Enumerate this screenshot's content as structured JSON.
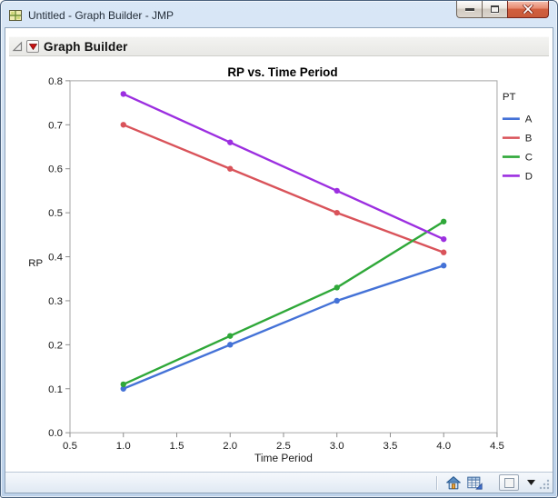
{
  "window": {
    "title": "Untitled - Graph Builder - JMP",
    "app_icon": "jmp-grid-icon",
    "controls": [
      {
        "id": "minimize",
        "icon": "minimize-icon"
      },
      {
        "id": "restore",
        "icon": "restore-icon"
      },
      {
        "id": "close",
        "icon": "close-icon"
      }
    ]
  },
  "report": {
    "outline_title": "Graph Builder",
    "disclosure_icon": "disclosure-triangle-icon",
    "menu_icon": "red-triangle-menu-icon"
  },
  "chart_data": {
    "type": "line",
    "title": "RP vs. Time Period",
    "xlabel": "Time Period",
    "ylabel": "RP",
    "legend_title": "PT",
    "legend_position": "right",
    "grid": false,
    "xlim": [
      0.5,
      4.5
    ],
    "ylim": [
      0.0,
      0.8
    ],
    "x_ticks": [
      0.5,
      1.0,
      1.5,
      2.0,
      2.5,
      3.0,
      3.5,
      4.0,
      4.5
    ],
    "y_ticks": [
      0.0,
      0.1,
      0.2,
      0.3,
      0.4,
      0.5,
      0.6,
      0.7,
      0.8
    ],
    "x": [
      1,
      2,
      3,
      4
    ],
    "series": [
      {
        "name": "A",
        "color": "#4472d7",
        "values": [
          0.1,
          0.2,
          0.3,
          0.38
        ]
      },
      {
        "name": "B",
        "color": "#d9535a",
        "values": [
          0.7,
          0.6,
          0.5,
          0.41
        ]
      },
      {
        "name": "C",
        "color": "#2fa839",
        "values": [
          0.11,
          0.22,
          0.33,
          0.48
        ]
      },
      {
        "name": "D",
        "color": "#9c2fe0",
        "values": [
          0.77,
          0.66,
          0.55,
          0.44
        ]
      }
    ]
  },
  "statusbar": {
    "icons": [
      "home-icon",
      "data-table-icon",
      "blank-square-button",
      "dropdown-triangle-icon",
      "resize-grip-icon"
    ]
  }
}
